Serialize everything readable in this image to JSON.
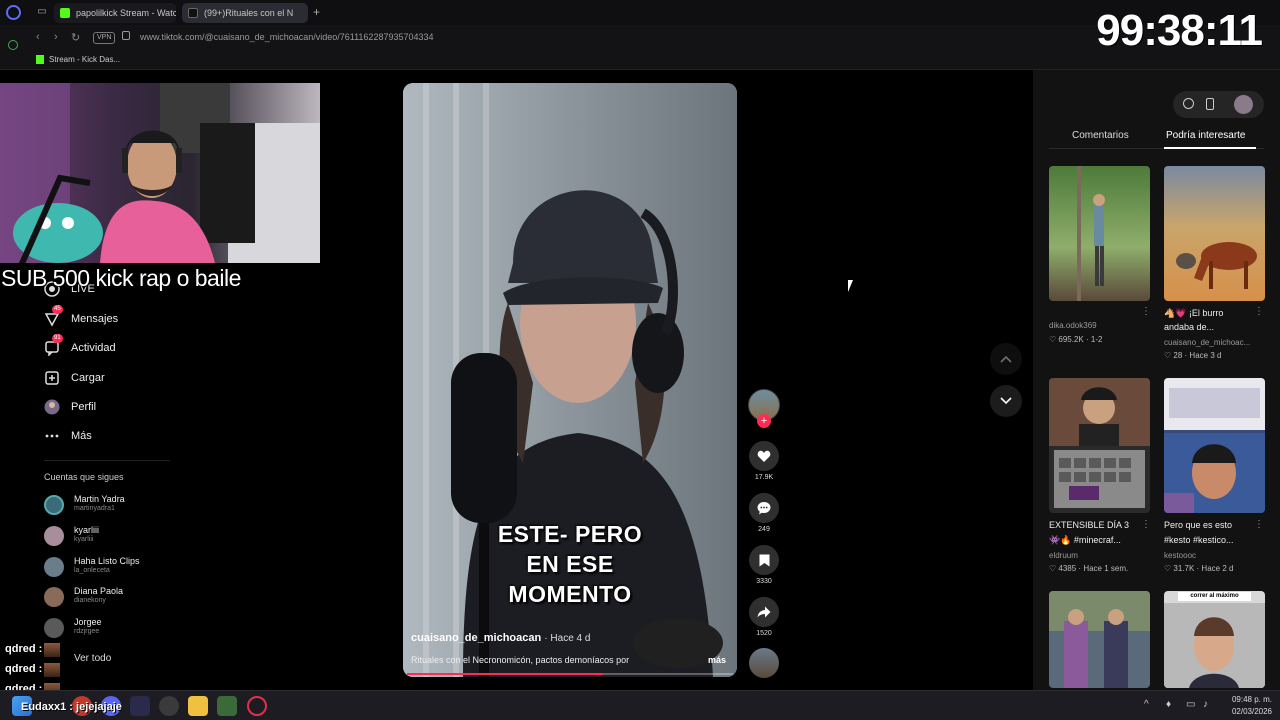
{
  "browser": {
    "tabs": [
      {
        "label": "papolilkick Stream - Watc",
        "fav_color": "#53fc18"
      },
      {
        "label": "(99+)Rituales con el N",
        "fav_color": "#000000"
      }
    ],
    "url": "www.tiktok.com/@cuaisano_de_michoacan/video/7611162287935704334",
    "vpn": "VPN",
    "bookmark": "Stream - Kick Das..."
  },
  "overlay": {
    "timer": "99:38:11",
    "sub_text": "SUB 500 kick  rap o  baile",
    "chat": [
      {
        "user": "qdred :"
      },
      {
        "user": "qdred :"
      },
      {
        "user": "qdred :"
      }
    ],
    "chat_bottom": "Eudaxx1 : jejejajaje"
  },
  "sidebar": {
    "items": [
      {
        "label": "LIVE",
        "icon": "live-icon"
      },
      {
        "label": "Mensajes",
        "icon": "messages-icon",
        "badge": "45"
      },
      {
        "label": "Actividad",
        "icon": "activity-icon",
        "badge": "91"
      },
      {
        "label": "Cargar",
        "icon": "upload-icon"
      },
      {
        "label": "Perfil",
        "icon": "profile-icon"
      },
      {
        "label": "Más",
        "icon": "more-icon"
      }
    ],
    "following_title": "Cuentas que sigues",
    "following": [
      {
        "name": "Martin Yadra",
        "handle": "martinyadra1",
        "color": "#3a6b7a"
      },
      {
        "name": "kyarliii",
        "handle": "kyarliii",
        "color": "#a78e9a"
      },
      {
        "name": "Haha Listo Clips",
        "handle": "la_onleceta",
        "color": "#6b7c8a"
      },
      {
        "name": "Diana Paola",
        "handle": "dianekony",
        "color": "#8a6b5a"
      },
      {
        "name": "Jorgee",
        "handle": "rdzjrgee",
        "color": "#5a5a5a"
      }
    ],
    "see_all": "Ver todo"
  },
  "video": {
    "caption": [
      "ESTE- PERO",
      "EN ESE",
      "MOMENTO"
    ],
    "author": "cuaisano_de_michoacan",
    "posted": "Hace 4 d",
    "description": "Rituales con el Necronomicón, pactos demoníacos por",
    "more": "más",
    "progress": 0.6
  },
  "actions": {
    "likes": "17.9K",
    "comments": "249",
    "saves": "3330",
    "shares": "1520"
  },
  "right_panel": {
    "tabs": [
      "Comentarios",
      "Podría interesarte"
    ],
    "cards": [
      {
        "title": "",
        "user": "dika.odok369",
        "likes": "695.2K",
        "date": "1-2",
        "colors": [
          "#4d7a3a",
          "#8fae6b",
          "#4a3a2a"
        ]
      },
      {
        "title": "🐴💗 ¡El burro",
        "title2": "andaba de...",
        "user": "cuaisano_de_michoac...",
        "likes": "28",
        "date": "Hace 3 d",
        "colors": [
          "#c9a56a",
          "#d6904a",
          "#7a6a3a"
        ]
      },
      {
        "title": "EXTENSIBLE DÍA 3",
        "title2": "👾🔥 #minecraf...",
        "user": "eldruum",
        "likes": "4385",
        "date": "Hace 1 sem.",
        "colors": [
          "#6a4a3a",
          "#3a3a3a",
          "#9a9a9a"
        ]
      },
      {
        "title": "Pero que es esto",
        "title2": "#kesto #kestico...",
        "user": "kestoooc",
        "likes": "31.7K",
        "date": "Hace 2 d",
        "colors": [
          "#3a4a7a",
          "#c96a3a",
          "#7a5a9a"
        ]
      },
      {
        "title": "",
        "user": "",
        "likes": "",
        "date": "",
        "colors": [
          "#5a6a7a",
          "#8a6a9a",
          "#3a3a5a"
        ]
      },
      {
        "title": "",
        "label": "correr al máximo",
        "user": "",
        "likes": "",
        "date": "",
        "colors": [
          "#d8d8d8",
          "#a8a8a8",
          "#6a6a6a"
        ]
      }
    ]
  },
  "taskbar": {
    "time": "09:48 p. m.",
    "date": "02/03/2026"
  },
  "colors": {
    "accent": "#fe2c55",
    "kick_green": "#53fc18"
  }
}
